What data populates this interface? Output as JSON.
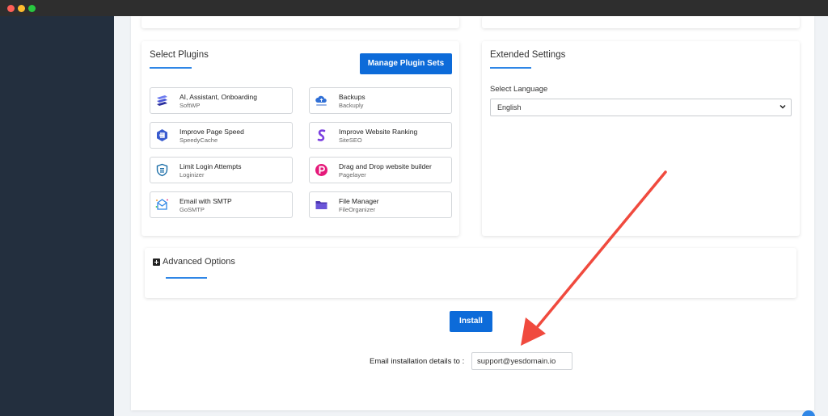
{
  "plugins_card": {
    "title": "Select Plugins",
    "manage_button": "Manage Plugin Sets",
    "items": [
      {
        "name": "AI, Assistant, Onboarding",
        "slug": "SoftWP",
        "icon": "softwp-icon",
        "color": "#4a56d6"
      },
      {
        "name": "Backups",
        "slug": "Backuply",
        "icon": "backuply-cloud-icon",
        "color": "#2f6fd6"
      },
      {
        "name": "Improve Page Speed",
        "slug": "SpeedyCache",
        "icon": "speedycache-icon",
        "color": "#3a5ccf"
      },
      {
        "name": "Improve Website Ranking",
        "slug": "SiteSEO",
        "icon": "siteseo-icon",
        "color": "#7a3fe0"
      },
      {
        "name": "Limit Login Attempts",
        "slug": "Loginizer",
        "icon": "loginizer-shield-icon",
        "color": "#1d6fa8"
      },
      {
        "name": "Drag and Drop website builder",
        "slug": "Pagelayer",
        "icon": "pagelayer-icon",
        "color": "#e5197a"
      },
      {
        "name": "Email with SMTP",
        "slug": "GoSMTP",
        "icon": "gosmtp-icon",
        "color": "#2f86e6"
      },
      {
        "name": "File Manager",
        "slug": "FileOrganizer",
        "icon": "fileorganizer-folder-icon",
        "color": "#4b35b0"
      }
    ]
  },
  "extended_card": {
    "title": "Extended Settings",
    "language_label": "Select Language",
    "language_value": "English"
  },
  "advanced": {
    "title": "Advanced Options"
  },
  "install": {
    "button": "Install",
    "email_label": "Email installation details to :",
    "email_value": "support@yesdomain.io"
  },
  "colors": {
    "primary": "#0d6bd9",
    "accent_line": "#2f86e6",
    "annotation_arrow": "#f04a3e"
  }
}
